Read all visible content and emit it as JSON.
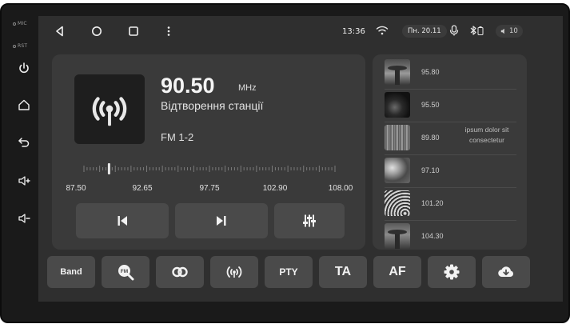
{
  "hardware": {
    "mic_label": "MIC",
    "rst_label": "RST",
    "buttons": [
      "power-icon",
      "home-icon",
      "back-icon",
      "volume-up-icon",
      "volume-down-icon"
    ]
  },
  "status_bar": {
    "time": "13:36",
    "date": "Пн. 20.11",
    "volume": "10",
    "icons": [
      "back-triangle-icon",
      "home-circle-icon",
      "recents-square-icon",
      "more-vert-icon",
      "wifi-icon",
      "mic-icon",
      "bluetooth-icon",
      "battery-icon",
      "speaker-icon"
    ]
  },
  "radio": {
    "frequency": "90.50",
    "unit": "MHz",
    "station_name": "Відтворення станції",
    "band": "FM 1-2",
    "tuner_position": 0.1,
    "scale": [
      "87.50",
      "92.65",
      "97.75",
      "102.90",
      "108.00"
    ],
    "controls": [
      "prev-icon",
      "next-icon",
      "equalizer-icon"
    ]
  },
  "stations": [
    {
      "freq": "95.80",
      "name": ""
    },
    {
      "freq": "95.50",
      "name": ""
    },
    {
      "freq": "89.80",
      "name": "ipsum dolor sit consectetur"
    },
    {
      "freq": "97.10",
      "name": ""
    },
    {
      "freq": "101.20",
      "name": ""
    },
    {
      "freq": "104.30",
      "name": ""
    }
  ],
  "bottom_bar": {
    "band": "Band",
    "pty": "PTY",
    "ta": "TA",
    "af": "AF",
    "icons": [
      "fm-search-icon",
      "stereo-icon",
      "broadcast-icon",
      "settings-icon",
      "cloud-download-icon"
    ]
  },
  "colors": {
    "screen": "#2f2f2f",
    "panel": "#3a3a3a",
    "button": "#4a4a4a",
    "text": "#f2f2f2"
  }
}
